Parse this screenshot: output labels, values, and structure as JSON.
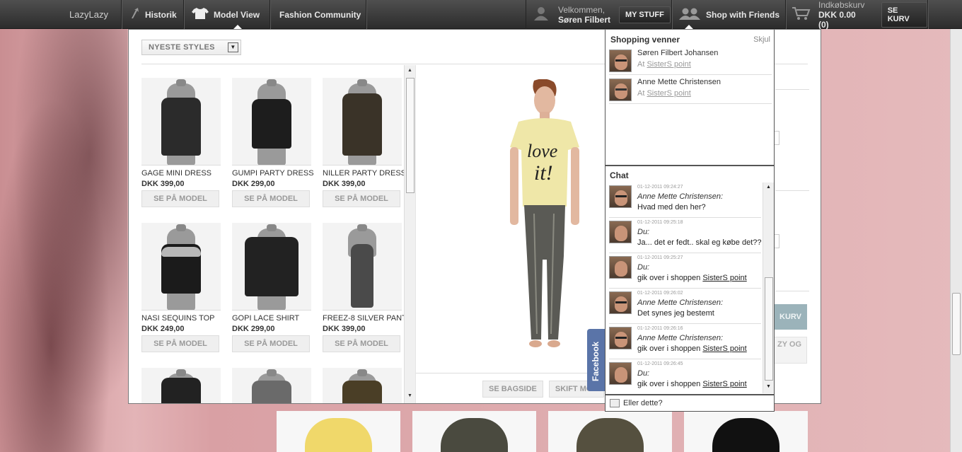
{
  "topbar": {
    "logo": "LazyLazy",
    "history": "Historik",
    "model_view": "Model View",
    "community": "Fashion Community",
    "welcome_line1": "Velkommen,",
    "welcome_name": "Søren Filbert",
    "my_stuff": "MY STUFF",
    "shop_with_friends": "Shop with Friends",
    "cart_title": "Indkøbskurv",
    "cart_total": "DKK 0.00 (0)",
    "see_cart": "SE KURV"
  },
  "filter": {
    "selected": "NYESTE STYLES"
  },
  "products": [
    {
      "name": "GAGE MINI DRESS",
      "price": "DKK 399,00",
      "button": "SE PÅ MODEL",
      "color": "#2b2b2b"
    },
    {
      "name": "GUMPI PARTY DRESS",
      "price": "DKK 299,00",
      "button": "SE PÅ MODEL",
      "color": "#1d1d1d"
    },
    {
      "name": "NILLER PARTY DRESS",
      "price": "DKK 399,00",
      "button": "SE PÅ MODEL",
      "color": "#3a3328"
    },
    {
      "name": "NASI SEQUINS TOP",
      "price": "DKK 249,00",
      "button": "SE PÅ MODEL",
      "color": "#1b1b1b"
    },
    {
      "name": "GOPI LACE SHIRT",
      "price": "DKK 299,00",
      "button": "SE PÅ MODEL",
      "color": "#222"
    },
    {
      "name": "FREEZ-8 SILVER PANT",
      "price": "DKK 399,00",
      "button": "SE PÅ MODEL",
      "color": "#4a4a4a"
    },
    {
      "name": "",
      "price": "",
      "button": "",
      "color": "#222"
    },
    {
      "name": "",
      "price": "",
      "button": "",
      "color": "#6a6a6a"
    },
    {
      "name": "",
      "price": "",
      "button": "",
      "color": "#4a3e26"
    }
  ],
  "model": {
    "btn_back": "SE BAGSIDE",
    "btn_switch": "SKIFT MOD"
  },
  "faded": {
    "cart_btn": "KURV",
    "partial_text": "ZY OG"
  },
  "friends_panel": {
    "title": "Shopping venner",
    "hide": "Skjul",
    "friends": [
      {
        "name": "Søren Filbert Johansen",
        "at": "At",
        "location": "SisterS point"
      },
      {
        "name": "Anne Mette Christensen",
        "at": "At",
        "location": "SisterS point"
      }
    ],
    "chat_title": "Chat",
    "messages": [
      {
        "time": "01-12-2011 09:24:27",
        "who": "Anne Mette Christensen:",
        "text": "Hvad med den her?",
        "link": ""
      },
      {
        "time": "01-12-2011 09:25:18",
        "who": "Du:",
        "text": "Ja... det er fedt.. skal eg købe det??",
        "link": ""
      },
      {
        "time": "01-12-2011 09:25:27",
        "who": "Du:",
        "text": "gik over i shoppen ",
        "link": "SisterS point"
      },
      {
        "time": "01-12-2011 09:26:02",
        "who": "Anne Mette Christensen:",
        "text": "Det synes jeg bestemt",
        "link": ""
      },
      {
        "time": "01-12-2011 09:26:16",
        "who": "Anne Mette Christensen:",
        "text": "gik over i shoppen ",
        "link": "SisterS point"
      },
      {
        "time": "01-12-2011 09:26:45",
        "who": "Du:",
        "text": "gik over i shoppen ",
        "link": "SisterS point"
      }
    ],
    "footer": "Eller dette?"
  },
  "facebook_tab": "Facebook"
}
